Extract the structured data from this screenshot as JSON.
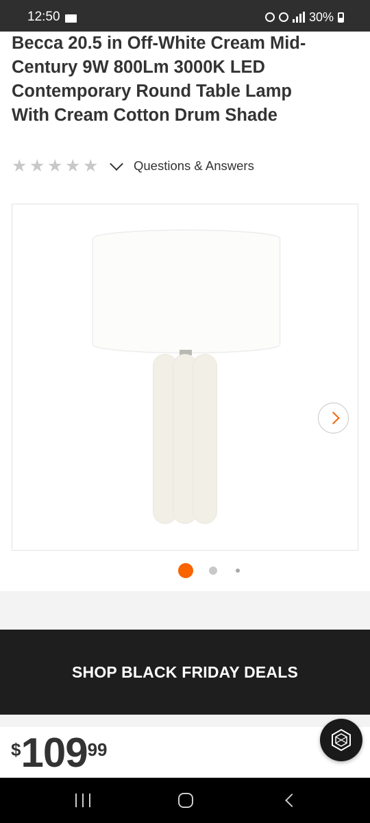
{
  "status_bar": {
    "time": "12:50",
    "battery": "30%",
    "icons": [
      "mail-icon",
      "lock-icon",
      "alarm-icon",
      "wifi-icon",
      "signal-icon",
      "battery-icon"
    ]
  },
  "product": {
    "title": "Becca 20.5 in Off-White Cream Mid-Century 9W 800Lm 3000K LED Contemporary Round Table Lamp With Cream Cotton Drum Shade",
    "rating": {
      "stars_filled": 0,
      "stars_total": 5
    },
    "qa_label": "Questions & Answers"
  },
  "gallery": {
    "image_subject": "off-white table lamp with cream drum shade",
    "current_index": 1,
    "total_indicators": 3
  },
  "promo": {
    "label": "SHOP BLACK FRIDAY DEALS"
  },
  "price": {
    "currency_symbol": "$",
    "dollars": "109",
    "cents": "99"
  },
  "colors": {
    "accent": "#f96302",
    "banner_bg": "#1e1e1e",
    "text": "#333333"
  }
}
